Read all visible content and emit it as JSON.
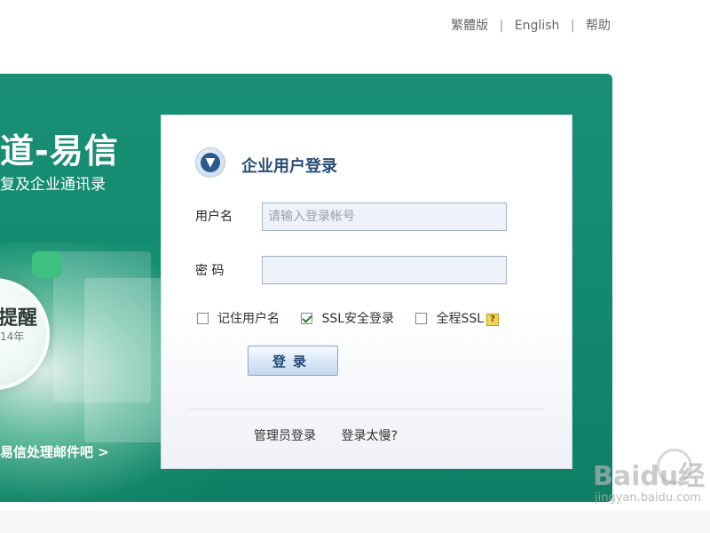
{
  "top_links": {
    "traditional": "繁體版",
    "separator": "|",
    "english": "English",
    "help": "帮助"
  },
  "banner": {
    "headline": "道-易信",
    "subline": "复及企业通讯录",
    "circle_text": "提醒",
    "circle_sub": "14年",
    "cta": "易信处理邮件吧 >",
    "accent_color": "#138a70"
  },
  "login": {
    "icon": "download-arrow-icon",
    "title": "企业用户登录",
    "username_label": "用户名",
    "username_placeholder": "请输入登录帐号",
    "username_value": "",
    "password_label": "密 码",
    "password_value": "",
    "remember_label": "记住用户名",
    "remember_checked": false,
    "ssl_label": "SSL安全登录",
    "ssl_checked": true,
    "full_ssl_label": "全程SSL",
    "full_ssl_checked": false,
    "help_icon": "?",
    "submit_label": "登录",
    "admin_link": "管理员登录",
    "slow_link": "登录太慢?"
  },
  "watermark": {
    "logo": "Baidu经",
    "url": "jingyan.baidu.com"
  }
}
